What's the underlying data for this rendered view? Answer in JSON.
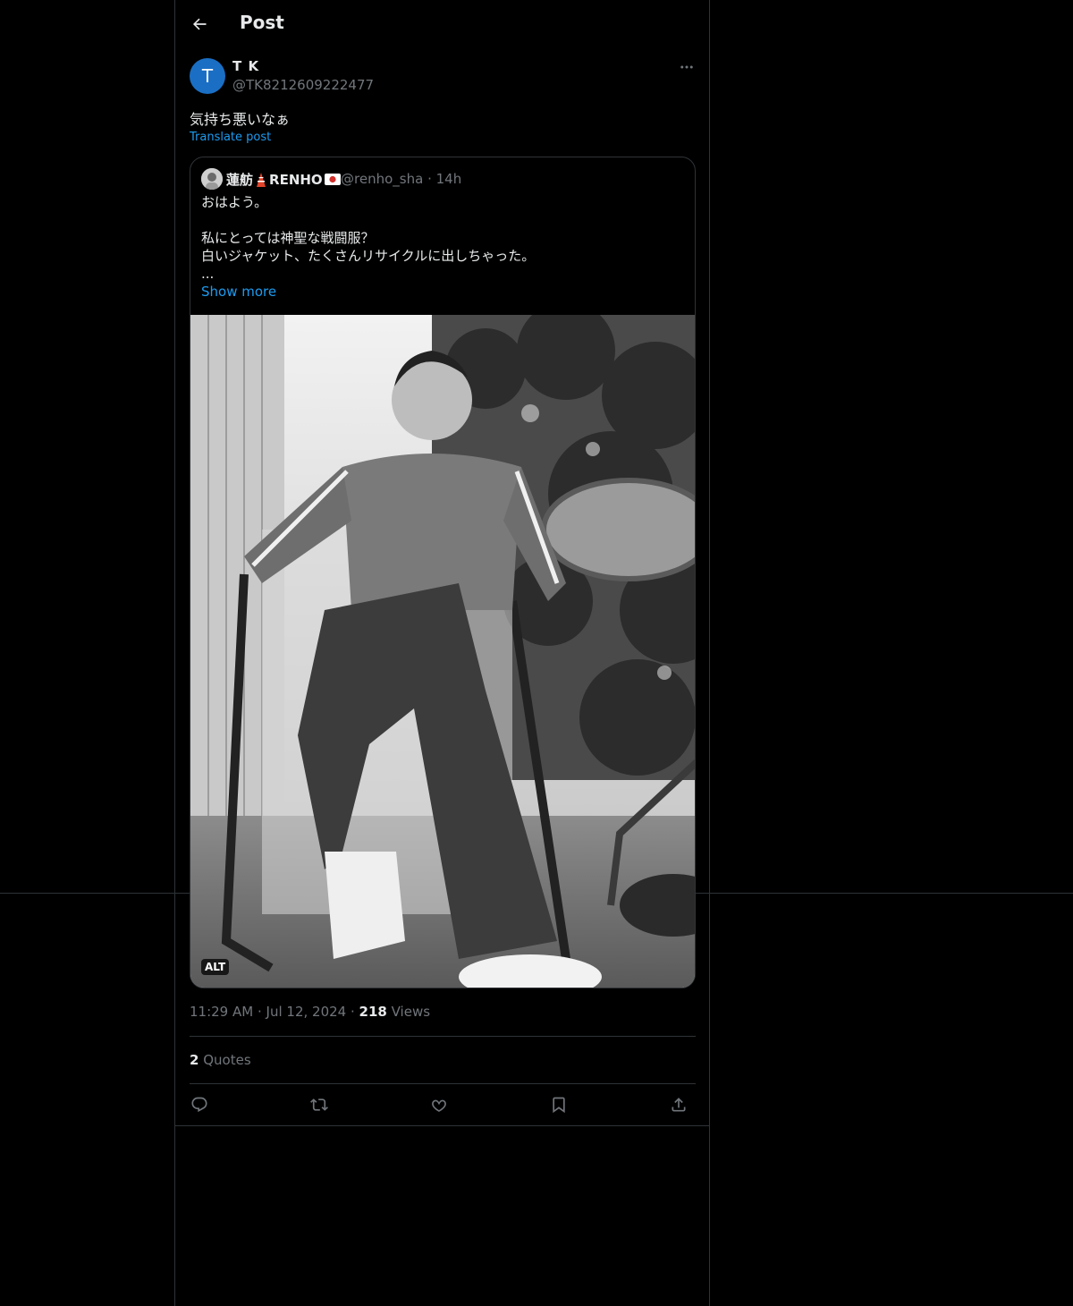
{
  "header": {
    "title": "Post"
  },
  "post": {
    "author": {
      "name": "T K",
      "handle": "@TK8212609222477",
      "avatar_letter": "T",
      "avatar_color": "#1a6fc4"
    },
    "text": "気持ち悪いなぁ",
    "translate_label": "Translate post",
    "quoted": {
      "name": "蓮舫",
      "name_suffix": "RENHO",
      "handle": "@renho_sha",
      "time": "14h",
      "lines": [
        "おはよう。",
        "",
        "私にとっては神聖な戦闘服？",
        "白いジャケット、たくさんリサイクルに出しちゃった。",
        "..."
      ],
      "show_more_label": "Show more",
      "alt_badge": "ALT"
    },
    "timestamp_time": "11:29 AM",
    "timestamp_date": "Jul 12, 2024",
    "views_count": "218",
    "views_label": "Views",
    "quotes_count": "2",
    "quotes_label": "Quotes"
  },
  "icons": {
    "back": "arrow-left-icon",
    "more": "more-horizontal-icon",
    "reply": "reply-icon",
    "repost": "repost-icon",
    "like": "heart-icon",
    "bookmark": "bookmark-icon",
    "share": "share-icon"
  },
  "colors": {
    "background": "#000000",
    "border": "#2f3336",
    "accent": "#1d9bf0",
    "secondary_text": "#71767b",
    "primary_text": "#e7e9ea"
  }
}
